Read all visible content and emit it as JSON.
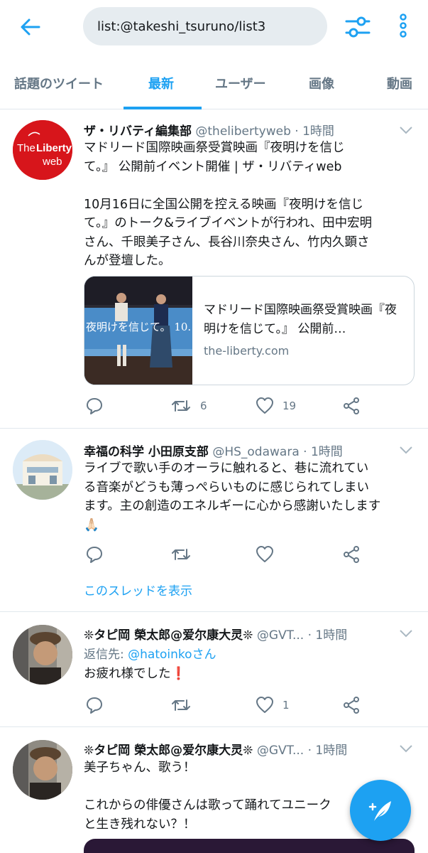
{
  "header": {
    "search_value": "list:@takeshi_tsuruno/list3"
  },
  "tabs": [
    {
      "label": "話題のツイート"
    },
    {
      "label": "最新"
    },
    {
      "label": "ユーザー"
    },
    {
      "label": "画像"
    },
    {
      "label": "動画"
    }
  ],
  "tweets": [
    {
      "avatar_text": "TheLiberty web",
      "name": "ザ・リバティ編集部",
      "handle": "@thelibertyweb",
      "time": "· 1時間",
      "text": "マドリード国際映画祭受賞映画『夜明けを信じ\nて。』 公開前イベント開催 | ザ・リバティweb\n\n10月16日に全国公開を控える映画『夜明けを信じ\nて。』のトーク&ライブイベントが行われ、田中宏明\nさん、千眼美子さん、長谷川奈央さん、竹内久顕さ\nんが登壇した。",
      "card": {
        "image_caption": "夜明けを信じて。 10.",
        "title": "マドリード国際映画祭受賞映画『夜明けを信じて。』 公開前…",
        "domain": "the-liberty.com"
      },
      "retweets": "6",
      "likes": "19"
    },
    {
      "name": "幸福の科学 小田原支部",
      "handle": "@HS_odawara",
      "time": "· 1時間",
      "text": "ライブで歌い手のオーラに触れると、巷に流れてい\nる音楽がどうも薄っぺらいものに感じられてしまい\nます。主の創造のエネルギーに心から感謝いたします\n🙏🏻",
      "thread_link": "このスレッドを表示"
    },
    {
      "name": "❊タピ岡 榮太郎@爱尔康大灵❊",
      "handle": "@GVT...",
      "time": "· 1時間",
      "reply_prefix": "返信先: ",
      "reply_user": "@hatoinkoさん",
      "text": "お疲れ様でした❗",
      "likes": "1"
    },
    {
      "name": "❊タピ岡 榮太郎@爱尔康大灵❊",
      "handle": "@GVT...",
      "time": "· 1時間",
      "text": "美子ちゃん、歌う！\n\nこれからの俳優さんは歌って踊れてユニーク\nと生き残れない？！"
    }
  ],
  "colors": {
    "accent": "#1da1f2",
    "muted": "#657786",
    "liberty_red": "#d7151b"
  }
}
